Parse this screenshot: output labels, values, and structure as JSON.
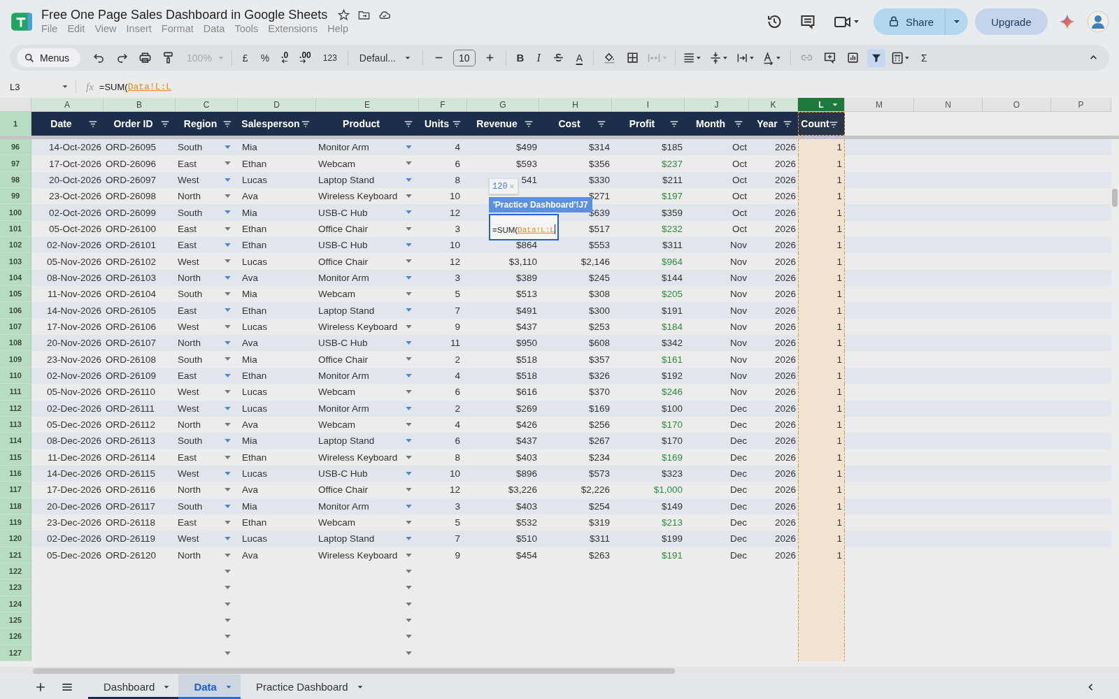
{
  "document": {
    "title": "Free One Page Sales Dashboard in Google Sheets"
  },
  "menu": [
    "File",
    "Edit",
    "View",
    "Insert",
    "Format",
    "Data",
    "Tools",
    "Extensions",
    "Help"
  ],
  "share": {
    "label": "Share"
  },
  "upgrade": {
    "label": "Upgrade"
  },
  "toolbar": {
    "search": "Menus",
    "zoom": "100%",
    "currency": "£",
    "percent": "%",
    "decrease_decimals": ".0",
    "increase_decimals": ".00",
    "number_format": "123",
    "font": "Defaul...",
    "font_size": "10",
    "bold": "B",
    "italic": "I",
    "text_color": "A",
    "functions": "Σ",
    "filter_on": true
  },
  "formula_bar": {
    "cell": "L3",
    "fx_label": "fx",
    "prefix": "=SUM(",
    "reference": "Data!L:L"
  },
  "columns": [
    {
      "letter": "A",
      "title": "Date",
      "highlighted": true,
      "selected": false
    },
    {
      "letter": "B",
      "title": "Order ID",
      "highlighted": true,
      "selected": false
    },
    {
      "letter": "C",
      "title": "Region",
      "highlighted": true,
      "selected": false
    },
    {
      "letter": "D",
      "title": "Salesperson",
      "highlighted": true,
      "selected": false
    },
    {
      "letter": "E",
      "title": "Product",
      "highlighted": true,
      "selected": false
    },
    {
      "letter": "F",
      "title": "Units",
      "highlighted": true,
      "selected": false
    },
    {
      "letter": "G",
      "title": "Revenue",
      "highlighted": true,
      "selected": false
    },
    {
      "letter": "H",
      "title": "Cost",
      "highlighted": true,
      "selected": false
    },
    {
      "letter": "I",
      "title": "Profit",
      "highlighted": true,
      "selected": false
    },
    {
      "letter": "J",
      "title": "Month",
      "highlighted": true,
      "selected": false
    },
    {
      "letter": "K",
      "title": "Year",
      "highlighted": true,
      "selected": false
    },
    {
      "letter": "L",
      "title": "Count",
      "highlighted": true,
      "selected": true
    },
    {
      "letter": "M",
      "highlighted": false,
      "selected": false
    },
    {
      "letter": "N",
      "highlighted": false,
      "selected": false
    },
    {
      "letter": "O",
      "highlighted": false,
      "selected": false
    },
    {
      "letter": "P",
      "highlighted": false,
      "selected": false
    }
  ],
  "header_row_number": "1",
  "rows": [
    {
      "n": "96",
      "date": "14-Oct-2026",
      "id": "ORD-26095",
      "region": "South",
      "person": "Mia",
      "product": "Monitor Arm",
      "units": "4",
      "revenue": "$499",
      "cost": "$314",
      "profit": "$185",
      "profit_highlighted": false,
      "month": "Oct",
      "year": "2026",
      "count": "1"
    },
    {
      "n": "97",
      "date": "17-Oct-2026",
      "id": "ORD-26096",
      "region": "East",
      "person": "Ethan",
      "product": "Webcam",
      "units": "6",
      "revenue": "$593",
      "cost": "$356",
      "profit": "$237",
      "profit_highlighted": true,
      "month": "Oct",
      "year": "2026",
      "count": "1"
    },
    {
      "n": "98",
      "date": "20-Oct-2026",
      "id": "ORD-26097",
      "region": "West",
      "person": "Lucas",
      "product": "Laptop Stand",
      "units": "8",
      "revenue": "541",
      "cost": "$330",
      "profit": "$211",
      "profit_highlighted": false,
      "month": "Oct",
      "year": "2026",
      "count": "1"
    },
    {
      "n": "99",
      "date": "23-Oct-2026",
      "id": "ORD-26098",
      "region": "North",
      "person": "Ava",
      "product": "Wireless Keyboard",
      "units": "10",
      "cost": "$271",
      "profit": "$197",
      "profit_highlighted": true,
      "month": "Oct",
      "year": "2026",
      "count": "1"
    },
    {
      "n": "100",
      "date": "02-Oct-2026",
      "id": "ORD-26099",
      "region": "South",
      "person": "Mia",
      "product": "USB-C Hub",
      "units": "12",
      "cost": "$639",
      "profit": "$359",
      "profit_highlighted": false,
      "month": "Oct",
      "year": "2026",
      "count": "1"
    },
    {
      "n": "101",
      "date": "05-Oct-2026",
      "id": "ORD-26100",
      "region": "East",
      "person": "Ethan",
      "product": "Office Chair",
      "units": "3",
      "cost": "$517",
      "profit": "$232",
      "profit_highlighted": true,
      "month": "Oct",
      "year": "2026",
      "count": "1"
    },
    {
      "n": "102",
      "date": "02-Nov-2026",
      "id": "ORD-26101",
      "region": "East",
      "person": "Ethan",
      "product": "USB-C Hub",
      "units": "10",
      "revenue": "$864",
      "cost": "$553",
      "profit": "$311",
      "profit_highlighted": false,
      "month": "Nov",
      "year": "2026",
      "count": "1"
    },
    {
      "n": "103",
      "date": "05-Nov-2026",
      "id": "ORD-26102",
      "region": "West",
      "person": "Lucas",
      "product": "Office Chair",
      "units": "12",
      "revenue": "$3,110",
      "cost": "$2,146",
      "profit": "$964",
      "profit_highlighted": true,
      "month": "Nov",
      "year": "2026",
      "count": "1"
    },
    {
      "n": "104",
      "date": "08-Nov-2026",
      "id": "ORD-26103",
      "region": "North",
      "person": "Ava",
      "product": "Monitor Arm",
      "units": "3",
      "revenue": "$389",
      "cost": "$245",
      "profit": "$144",
      "profit_highlighted": false,
      "month": "Nov",
      "year": "2026",
      "count": "1"
    },
    {
      "n": "105",
      "date": "11-Nov-2026",
      "id": "ORD-26104",
      "region": "South",
      "person": "Mia",
      "product": "Webcam",
      "units": "5",
      "revenue": "$513",
      "cost": "$308",
      "profit": "$205",
      "profit_highlighted": true,
      "month": "Nov",
      "year": "2026",
      "count": "1"
    },
    {
      "n": "106",
      "date": "14-Nov-2026",
      "id": "ORD-26105",
      "region": "East",
      "person": "Ethan",
      "product": "Laptop Stand",
      "units": "7",
      "revenue": "$491",
      "cost": "$300",
      "profit": "$191",
      "profit_highlighted": false,
      "month": "Nov",
      "year": "2026",
      "count": "1"
    },
    {
      "n": "107",
      "date": "17-Nov-2026",
      "id": "ORD-26106",
      "region": "West",
      "person": "Lucas",
      "product": "Wireless Keyboard",
      "units": "9",
      "revenue": "$437",
      "cost": "$253",
      "profit": "$184",
      "profit_highlighted": true,
      "month": "Nov",
      "year": "2026",
      "count": "1"
    },
    {
      "n": "108",
      "date": "20-Nov-2026",
      "id": "ORD-26107",
      "region": "North",
      "person": "Ava",
      "product": "USB-C Hub",
      "units": "11",
      "revenue": "$950",
      "cost": "$608",
      "profit": "$342",
      "profit_highlighted": false,
      "month": "Nov",
      "year": "2026",
      "count": "1"
    },
    {
      "n": "109",
      "date": "23-Nov-2026",
      "id": "ORD-26108",
      "region": "South",
      "person": "Mia",
      "product": "Office Chair",
      "units": "2",
      "revenue": "$518",
      "cost": "$357",
      "profit": "$161",
      "profit_highlighted": true,
      "month": "Nov",
      "year": "2026",
      "count": "1"
    },
    {
      "n": "110",
      "date": "02-Nov-2026",
      "id": "ORD-26109",
      "region": "East",
      "person": "Ethan",
      "product": "Monitor Arm",
      "units": "4",
      "revenue": "$518",
      "cost": "$326",
      "profit": "$192",
      "profit_highlighted": false,
      "month": "Nov",
      "year": "2026",
      "count": "1"
    },
    {
      "n": "111",
      "date": "05-Nov-2026",
      "id": "ORD-26110",
      "region": "West",
      "person": "Lucas",
      "product": "Webcam",
      "units": "6",
      "revenue": "$616",
      "cost": "$370",
      "profit": "$246",
      "profit_highlighted": true,
      "month": "Nov",
      "year": "2026",
      "count": "1"
    },
    {
      "n": "112",
      "date": "02-Dec-2026",
      "id": "ORD-26111",
      "region": "West",
      "person": "Lucas",
      "product": "Monitor Arm",
      "units": "2",
      "revenue": "$269",
      "cost": "$169",
      "profit": "$100",
      "profit_highlighted": false,
      "month": "Dec",
      "year": "2026",
      "count": "1"
    },
    {
      "n": "113",
      "date": "05-Dec-2026",
      "id": "ORD-26112",
      "region": "North",
      "person": "Ava",
      "product": "Webcam",
      "units": "4",
      "revenue": "$426",
      "cost": "$256",
      "profit": "$170",
      "profit_highlighted": true,
      "month": "Dec",
      "year": "2026",
      "count": "1"
    },
    {
      "n": "114",
      "date": "08-Dec-2026",
      "id": "ORD-26113",
      "region": "South",
      "person": "Mia",
      "product": "Laptop Stand",
      "units": "6",
      "revenue": "$437",
      "cost": "$267",
      "profit": "$170",
      "profit_highlighted": false,
      "month": "Dec",
      "year": "2026",
      "count": "1"
    },
    {
      "n": "115",
      "date": "11-Dec-2026",
      "id": "ORD-26114",
      "region": "East",
      "person": "Ethan",
      "product": "Wireless Keyboard",
      "units": "8",
      "revenue": "$403",
      "cost": "$234",
      "profit": "$169",
      "profit_highlighted": true,
      "month": "Dec",
      "year": "2026",
      "count": "1"
    },
    {
      "n": "116",
      "date": "14-Dec-2026",
      "id": "ORD-26115",
      "region": "West",
      "person": "Lucas",
      "product": "USB-C Hub",
      "units": "10",
      "revenue": "$896",
      "cost": "$573",
      "profit": "$323",
      "profit_highlighted": false,
      "month": "Dec",
      "year": "2026",
      "count": "1"
    },
    {
      "n": "117",
      "date": "17-Dec-2026",
      "id": "ORD-26116",
      "region": "North",
      "person": "Ava",
      "product": "Office Chair",
      "units": "12",
      "revenue": "$3,226",
      "cost": "$2,226",
      "profit": "$1,000",
      "profit_highlighted": true,
      "month": "Dec",
      "year": "2026",
      "count": "1"
    },
    {
      "n": "118",
      "date": "20-Dec-2026",
      "id": "ORD-26117",
      "region": "South",
      "person": "Mia",
      "product": "Monitor Arm",
      "units": "3",
      "revenue": "$403",
      "cost": "$254",
      "profit": "$149",
      "profit_highlighted": false,
      "month": "Dec",
      "year": "2026",
      "count": "1"
    },
    {
      "n": "119",
      "date": "23-Dec-2026",
      "id": "ORD-26118",
      "region": "East",
      "person": "Ethan",
      "product": "Webcam",
      "units": "5",
      "revenue": "$532",
      "cost": "$319",
      "profit": "$213",
      "profit_highlighted": true,
      "month": "Dec",
      "year": "2026",
      "count": "1"
    },
    {
      "n": "120",
      "date": "02-Dec-2026",
      "id": "ORD-26119",
      "region": "West",
      "person": "Lucas",
      "product": "Laptop Stand",
      "units": "7",
      "revenue": "$510",
      "cost": "$311",
      "profit": "$199",
      "profit_highlighted": false,
      "month": "Dec",
      "year": "2026",
      "count": "1"
    },
    {
      "n": "121",
      "date": "05-Dec-2026",
      "id": "ORD-26120",
      "region": "North",
      "person": "Ava",
      "product": "Wireless Keyboard",
      "units": "9",
      "revenue": "$454",
      "cost": "$263",
      "profit": "$191",
      "profit_highlighted": true,
      "month": "Dec",
      "year": "2026",
      "count": "1"
    },
    {
      "n": "122"
    },
    {
      "n": "123"
    },
    {
      "n": "124"
    },
    {
      "n": "125"
    },
    {
      "n": "126"
    },
    {
      "n": "127"
    }
  ],
  "editor": {
    "result_preview": "120",
    "close": "×",
    "range_hint": "'Practice Dashboard'!J7",
    "prefix": "=SUM(",
    "reference": "Data!L:L"
  },
  "sheet_tabs": [
    {
      "label": "Dashboard",
      "selected": false,
      "color": "#1c2b49"
    },
    {
      "label": "Data",
      "selected": true
    },
    {
      "label": "Practice Dashboard",
      "selected": false
    }
  ]
}
